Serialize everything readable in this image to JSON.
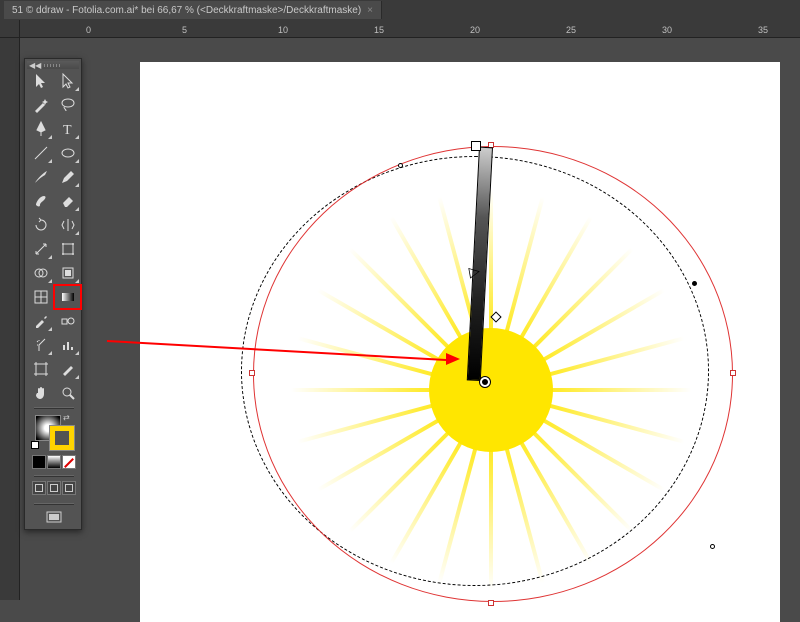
{
  "tab": {
    "title": "51 © ddraw - Fotolia.com.ai* bei 66,67 % (<Deckkraftmaske>/Deckkraftmaske)",
    "close": "×"
  },
  "ruler": {
    "ticks": [
      "0",
      "5",
      "10",
      "15",
      "20",
      "25",
      "30",
      "35"
    ]
  },
  "tools": {
    "selection": "Selection",
    "direct_select": "Direct Selection",
    "magic_wand": "Magic Wand",
    "lasso": "Lasso",
    "pen": "Pen",
    "type": "Type",
    "line": "Line Segment",
    "ellipse": "Ellipse",
    "brush": "Paintbrush",
    "pencil": "Pencil",
    "blob": "Blob Brush",
    "eraser": "Eraser",
    "rotate": "Rotate",
    "reflect": "Reflect",
    "scale": "Width",
    "free_transform": "Free Transform",
    "shape_builder": "Shape Builder",
    "perspective": "Live Paint",
    "mesh": "Mesh",
    "gradient": "Gradient",
    "eyedropper": "Eyedropper",
    "blend": "Blend",
    "symbol_sprayer": "Symbol Sprayer",
    "column_graph": "Column Graph",
    "artboard": "Artboard",
    "slice": "Slice",
    "hand": "Hand",
    "zoom": "Zoom"
  },
  "zoom_level": "66,67 %",
  "colors": {
    "sun": "#ffe600",
    "highlight": "#ff0000",
    "selection": "#dc1e1e"
  }
}
